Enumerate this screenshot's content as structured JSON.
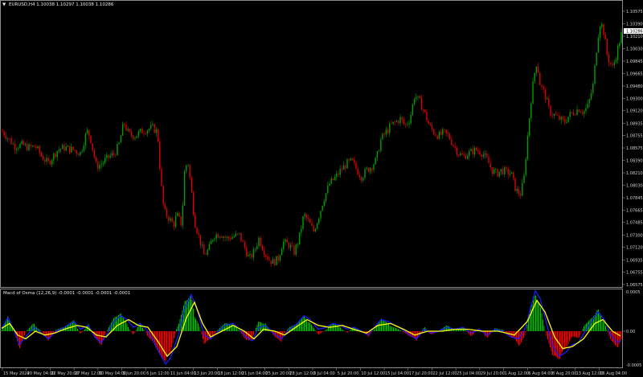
{
  "main_window": {
    "header_arrow": "▼",
    "title": "EURUSD,H4  1.10038 1.10297 1.10038 1.10286"
  },
  "indicator_window": {
    "title": "Macd of Osma (12,26,9) -0.0001 -0.0001 -0.0001 -0.0001"
  },
  "colors": {
    "background": "#000000",
    "bull_candle": "#00a000",
    "bear_candle": "#e00000",
    "macd_line": "#1a1aff",
    "signal_line": "#ffff00",
    "hist_up": "#00c000",
    "hist_down": "#ff0000",
    "grid": "#2a2a2a",
    "current_price_box": "#ffffff"
  },
  "chart_data": {
    "type": "candlestick",
    "symbol": "EURUSD",
    "timeframe": "H4",
    "current_price": "1.10286",
    "price_axis_ticks": [
      "1.10575",
      "1.10390",
      "1.10210",
      "1.10030",
      "1.09845",
      "1.09665",
      "1.09480",
      "1.09300",
      "1.09120",
      "1.08935",
      "1.08755",
      "1.08575",
      "1.08390",
      "1.08210",
      "1.08030",
      "1.07845",
      "1.07665",
      "1.07485",
      "1.07300",
      "1.07120",
      "1.06935",
      "1.06755",
      "1.06575"
    ],
    "time_axis_ticks": [
      "15 May 2024",
      "20 May 04:00",
      "22 May 20:00",
      "27 May 12:00",
      "30 May 04:00",
      "3 Jun 20:00",
      "6 Jun 12:00",
      "11 Jun 04:00",
      "13 Jun 20:00",
      "18 Jun 12:00",
      "21 Jun 04:00",
      "25 Jun 20:00",
      "28 Jun 12:00",
      "3 Jul 04:00",
      "5 Jul 20:00",
      "10 Jul 12:00",
      "15 Jul 04:00",
      "17 Jul 20:00",
      "22 Jul 12:00",
      "25 Jul 04:00",
      "29 Jul 20:00",
      "1 Aug 12:00",
      "6 Aug 04:00",
      "8 Aug 20:00",
      "13 Aug 12:00",
      "16 Aug 04:00"
    ],
    "ylim": [
      1.06575,
      1.10575
    ],
    "close_path": [
      [
        0,
        1.0885
      ],
      [
        8,
        1.0875
      ],
      [
        18,
        1.086
      ],
      [
        28,
        1.0862
      ],
      [
        36,
        1.0858
      ],
      [
        44,
        1.086
      ],
      [
        52,
        1.0845
      ],
      [
        60,
        1.0835
      ],
      [
        72,
        1.0855
      ],
      [
        80,
        1.0858
      ],
      [
        90,
        1.0855
      ],
      [
        100,
        1.085
      ],
      [
        108,
        1.0882
      ],
      [
        112,
        1.0875
      ],
      [
        120,
        1.083
      ],
      [
        128,
        1.0836
      ],
      [
        136,
        1.0845
      ],
      [
        142,
        1.0848
      ],
      [
        148,
        1.0862
      ],
      [
        154,
        1.0895
      ],
      [
        160,
        1.0878
      ],
      [
        168,
        1.0875
      ],
      [
        176,
        1.0882
      ],
      [
        184,
        1.0885
      ],
      [
        190,
        1.0887
      ],
      [
        196,
        1.088
      ],
      [
        200,
        1.081
      ],
      [
        204,
        1.0765
      ],
      [
        210,
        1.0755
      ],
      [
        216,
        1.0745
      ],
      [
        220,
        1.076
      ],
      [
        226,
        1.0745
      ],
      [
        230,
        1.083
      ],
      [
        234,
        1.0835
      ],
      [
        238,
        1.0795
      ],
      [
        242,
        1.075
      ],
      [
        248,
        1.0725
      ],
      [
        254,
        1.07
      ],
      [
        260,
        1.071
      ],
      [
        266,
        1.073
      ],
      [
        274,
        1.0732
      ],
      [
        282,
        1.0725
      ],
      [
        290,
        1.0728
      ],
      [
        298,
        1.073
      ],
      [
        304,
        1.0712
      ],
      [
        310,
        1.0695
      ],
      [
        316,
        1.0705
      ],
      [
        322,
        1.0725
      ],
      [
        328,
        1.0708
      ],
      [
        334,
        1.0695
      ],
      [
        340,
        1.069
      ],
      [
        346,
        1.0695
      ],
      [
        352,
        1.072
      ],
      [
        360,
        1.0715
      ],
      [
        366,
        1.0705
      ],
      [
        372,
        1.0725
      ],
      [
        378,
        1.076
      ],
      [
        384,
        1.075
      ],
      [
        390,
        1.0735
      ],
      [
        396,
        1.0755
      ],
      [
        402,
        1.078
      ],
      [
        410,
        1.0805
      ],
      [
        418,
        1.0815
      ],
      [
        424,
        1.0825
      ],
      [
        432,
        1.0835
      ],
      [
        438,
        1.0838
      ],
      [
        444,
        1.0825
      ],
      [
        450,
        1.0815
      ],
      [
        456,
        1.0825
      ],
      [
        462,
        1.083
      ],
      [
        468,
        1.084
      ],
      [
        474,
        1.087
      ],
      [
        480,
        1.088
      ],
      [
        486,
        1.089
      ],
      [
        492,
        1.0895
      ],
      [
        498,
        1.09
      ],
      [
        504,
        1.089
      ],
      [
        510,
        1.09
      ],
      [
        516,
        1.0935
      ],
      [
        522,
        1.0925
      ],
      [
        528,
        1.091
      ],
      [
        534,
        1.089
      ],
      [
        540,
        1.088
      ],
      [
        546,
        1.0875
      ],
      [
        552,
        1.088
      ],
      [
        558,
        1.0875
      ],
      [
        564,
        1.0862
      ],
      [
        570,
        1.085
      ],
      [
        576,
        1.0845
      ],
      [
        584,
        1.085
      ],
      [
        592,
        1.0855
      ],
      [
        600,
        1.085
      ],
      [
        606,
        1.084
      ],
      [
        612,
        1.0825
      ],
      [
        618,
        1.082
      ],
      [
        624,
        1.0825
      ],
      [
        630,
        1.0822
      ],
      [
        636,
        1.082
      ],
      [
        642,
        1.0795
      ],
      [
        648,
        1.079
      ],
      [
        652,
        1.0815
      ],
      [
        656,
        1.087
      ],
      [
        660,
        1.092
      ],
      [
        664,
        1.096
      ],
      [
        668,
        1.0985
      ],
      [
        672,
        1.095
      ],
      [
        678,
        1.0935
      ],
      [
        684,
        1.091
      ],
      [
        690,
        1.0905
      ],
      [
        696,
        1.09
      ],
      [
        702,
        1.0895
      ],
      [
        708,
        1.0905
      ],
      [
        714,
        1.091
      ],
      [
        720,
        1.0915
      ],
      [
        726,
        1.091
      ],
      [
        732,
        1.092
      ],
      [
        738,
        1.095
      ],
      [
        742,
        1.1
      ],
      [
        746,
        1.104
      ],
      [
        750,
        1.1035
      ],
      [
        756,
        1.099
      ],
      [
        762,
        1.0975
      ],
      [
        766,
        1.099
      ],
      [
        770,
        1.101
      ],
      [
        774,
        1.1028
      ]
    ],
    "macd_path": [
      [
        0,
        0.0
      ],
      [
        10,
        0.35
      ],
      [
        18,
        0.0
      ],
      [
        24,
        -0.35
      ],
      [
        32,
        -0.15
      ],
      [
        42,
        0.1
      ],
      [
        52,
        -0.05
      ],
      [
        60,
        -0.2
      ],
      [
        70,
        0.0
      ],
      [
        80,
        0.1
      ],
      [
        92,
        0.25
      ],
      [
        100,
        0.05
      ],
      [
        110,
        0.15
      ],
      [
        118,
        -0.15
      ],
      [
        126,
        -0.3
      ],
      [
        134,
        -0.05
      ],
      [
        142,
        0.25
      ],
      [
        150,
        0.4
      ],
      [
        158,
        0.3
      ],
      [
        166,
        0.1
      ],
      [
        174,
        0.2
      ],
      [
        182,
        0.05
      ],
      [
        190,
        -0.2
      ],
      [
        198,
        -0.55
      ],
      [
        206,
        -0.85
      ],
      [
        212,
        -0.7
      ],
      [
        222,
        -0.1
      ],
      [
        230,
        0.6
      ],
      [
        238,
        0.95
      ],
      [
        246,
        0.5
      ],
      [
        254,
        -0.1
      ],
      [
        262,
        -0.2
      ],
      [
        272,
        0.0
      ],
      [
        280,
        0.15
      ],
      [
        290,
        0.2
      ],
      [
        298,
        0.05
      ],
      [
        306,
        -0.15
      ],
      [
        314,
        -0.25
      ],
      [
        322,
        0.1
      ],
      [
        330,
        0.15
      ],
      [
        340,
        -0.05
      ],
      [
        350,
        -0.2
      ],
      [
        360,
        0.05
      ],
      [
        370,
        0.2
      ],
      [
        378,
        0.4
      ],
      [
        386,
        0.3
      ],
      [
        396,
        0.05
      ],
      [
        406,
        0.1
      ],
      [
        414,
        0.2
      ],
      [
        424,
        0.15
      ],
      [
        432,
        0.05
      ],
      [
        440,
        0.1
      ],
      [
        450,
        0.0
      ],
      [
        458,
        -0.1
      ],
      [
        466,
        0.1
      ],
      [
        474,
        0.3
      ],
      [
        482,
        0.25
      ],
      [
        492,
        0.15
      ],
      [
        500,
        0.05
      ],
      [
        510,
        -0.1
      ],
      [
        518,
        -0.2
      ],
      [
        528,
        0.05
      ],
      [
        536,
        -0.05
      ],
      [
        546,
        0.0
      ],
      [
        556,
        0.1
      ],
      [
        566,
        0.05
      ],
      [
        576,
        0.1
      ],
      [
        586,
        -0.05
      ],
      [
        596,
        0.05
      ],
      [
        606,
        -0.1
      ],
      [
        616,
        0.05
      ],
      [
        626,
        0.0
      ],
      [
        636,
        -0.15
      ],
      [
        646,
        -0.2
      ],
      [
        654,
        0.1
      ],
      [
        660,
        0.6
      ],
      [
        666,
        1.05
      ],
      [
        672,
        0.85
      ],
      [
        680,
        0.2
      ],
      [
        688,
        -0.4
      ],
      [
        696,
        -0.65
      ],
      [
        704,
        -0.55
      ],
      [
        712,
        -0.35
      ],
      [
        720,
        -0.3
      ],
      [
        728,
        0.0
      ],
      [
        736,
        0.25
      ],
      [
        744,
        0.5
      ],
      [
        752,
        0.3
      ],
      [
        760,
        -0.1
      ],
      [
        768,
        -0.3
      ],
      [
        774,
        -0.2
      ]
    ],
    "signal_path": [
      [
        0,
        0.05
      ],
      [
        12,
        0.2
      ],
      [
        22,
        -0.1
      ],
      [
        32,
        -0.2
      ],
      [
        44,
        0.0
      ],
      [
        56,
        -0.1
      ],
      [
        68,
        -0.05
      ],
      [
        80,
        0.05
      ],
      [
        96,
        0.15
      ],
      [
        108,
        0.1
      ],
      [
        120,
        -0.1
      ],
      [
        132,
        -0.15
      ],
      [
        146,
        0.15
      ],
      [
        160,
        0.3
      ],
      [
        172,
        0.15
      ],
      [
        184,
        0.1
      ],
      [
        196,
        -0.25
      ],
      [
        208,
        -0.65
      ],
      [
        220,
        -0.4
      ],
      [
        232,
        0.35
      ],
      [
        242,
        0.75
      ],
      [
        252,
        0.2
      ],
      [
        262,
        -0.15
      ],
      [
        276,
        0.0
      ],
      [
        290,
        0.15
      ],
      [
        304,
        0.0
      ],
      [
        316,
        -0.2
      ],
      [
        328,
        0.05
      ],
      [
        342,
        0.0
      ],
      [
        354,
        -0.1
      ],
      [
        368,
        0.1
      ],
      [
        382,
        0.3
      ],
      [
        396,
        0.15
      ],
      [
        410,
        0.1
      ],
      [
        426,
        0.15
      ],
      [
        440,
        0.05
      ],
      [
        456,
        -0.05
      ],
      [
        470,
        0.15
      ],
      [
        486,
        0.2
      ],
      [
        502,
        0.05
      ],
      [
        516,
        -0.1
      ],
      [
        532,
        0.0
      ],
      [
        550,
        0.0
      ],
      [
        566,
        0.05
      ],
      [
        582,
        0.05
      ],
      [
        600,
        0.0
      ],
      [
        620,
        0.0
      ],
      [
        640,
        -0.1
      ],
      [
        656,
        0.25
      ],
      [
        668,
        0.8
      ],
      [
        678,
        0.5
      ],
      [
        690,
        -0.15
      ],
      [
        700,
        -0.45
      ],
      [
        712,
        -0.4
      ],
      [
        726,
        -0.2
      ],
      [
        740,
        0.2
      ],
      [
        750,
        0.3
      ],
      [
        762,
        0.0
      ],
      [
        774,
        -0.15
      ]
    ]
  }
}
